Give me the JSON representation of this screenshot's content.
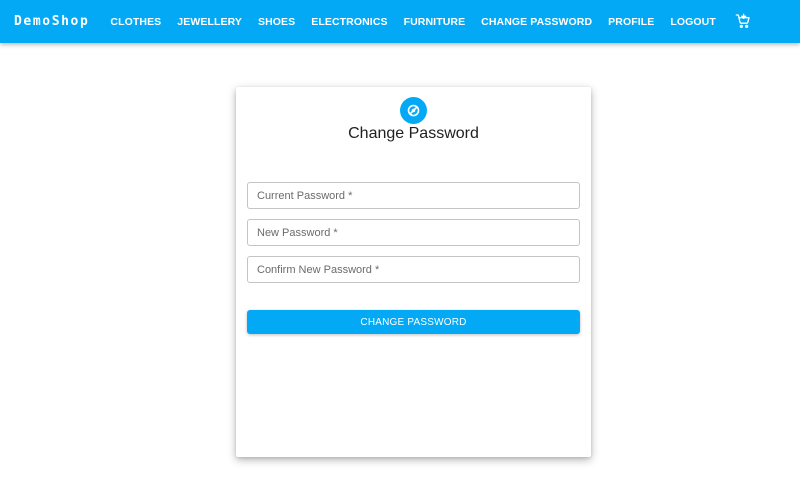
{
  "navbar": {
    "brand": "DemoShop",
    "links": [
      {
        "label": "CLOTHES"
      },
      {
        "label": "JEWELLERY"
      },
      {
        "label": "SHOES"
      },
      {
        "label": "ELECTRONICS"
      },
      {
        "label": "FURNITURE"
      },
      {
        "label": "CHANGE PASSWORD"
      },
      {
        "label": "PROFILE"
      },
      {
        "label": "LOGOUT"
      }
    ],
    "cart_icon": "cart-icon"
  },
  "form": {
    "icon": "lock-icon",
    "title": "Change Password",
    "fields": [
      {
        "label": "Current Password *",
        "value": ""
      },
      {
        "label": "New Password *",
        "value": ""
      },
      {
        "label": "Confirm New Password *",
        "value": ""
      }
    ],
    "submit_label": "CHANGE PASSWORD"
  },
  "colors": {
    "primary": "#03a9f4",
    "background": "#ffffff",
    "field_border": "#c4c4c4"
  }
}
